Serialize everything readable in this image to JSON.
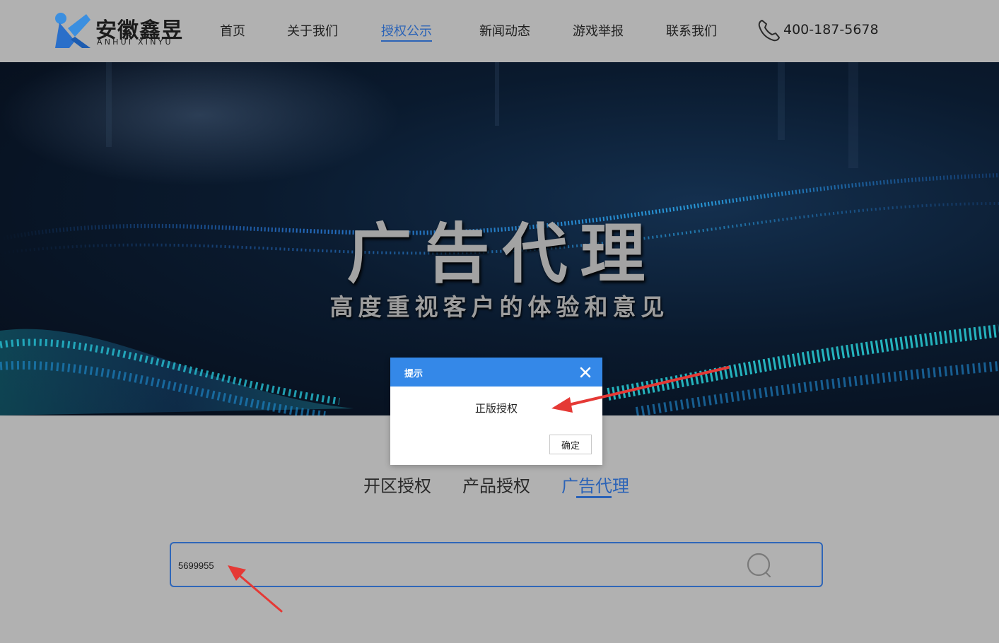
{
  "header": {
    "logo_cn": "安徽鑫昱",
    "logo_en": "ANHUI XINYU",
    "nav": [
      "首页",
      "关于我们",
      "授权公示",
      "新闻动态",
      "游戏举报",
      "联系我们"
    ],
    "active_nav": "授权公示",
    "phone": "400-187-5678"
  },
  "banner": {
    "title": "广告代理",
    "subtitle": "高度重视客户的体验和意见"
  },
  "tabs": [
    "开区授权",
    "产品授权",
    "广告代理"
  ],
  "active_tab": "广告代理",
  "search": {
    "value": "5699955"
  },
  "dialog": {
    "title": "提示",
    "message": "正版授权",
    "ok_label": "确定"
  },
  "colors": {
    "accent": "#2b63b7",
    "dialog_header": "#3488e8",
    "annotation_arrow": "#e53935",
    "page_bg": "#b1b1b1"
  },
  "icons": [
    "logo-mark-icon",
    "phone-icon",
    "search-icon",
    "close-icon",
    "arrow-annotation"
  ]
}
